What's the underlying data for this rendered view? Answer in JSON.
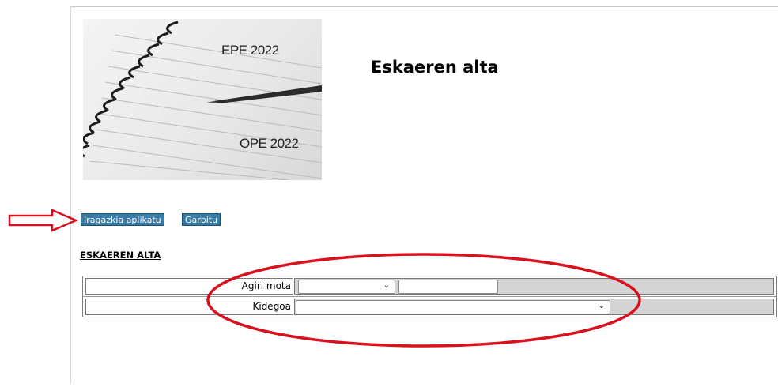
{
  "banner": {
    "line1": "EPE 2022",
    "line2": "OPE 2022"
  },
  "header": {
    "title": "Eskaeren alta"
  },
  "toolbar": {
    "apply_filter_label": "Iragazkia aplikatu",
    "clear_label": "Garbitu"
  },
  "section": {
    "title": "ESKAEREN ALTA"
  },
  "form": {
    "fields": [
      {
        "label": "Agiri mota",
        "selected": "",
        "text_value": ""
      },
      {
        "label": "Kidegoa",
        "selected": ""
      }
    ]
  },
  "annotations": {
    "arrow_color": "#d9101e",
    "ellipse_color": "#d9101e"
  }
}
